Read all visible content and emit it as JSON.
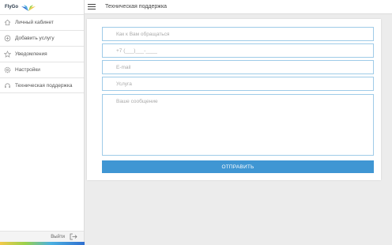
{
  "app": {
    "logo_text": "FlyGo"
  },
  "header": {
    "title": "Техническая поддержка"
  },
  "sidebar": {
    "items": [
      {
        "label": "Личный кабинет",
        "icon": "home-icon"
      },
      {
        "label": "Добавить услугу",
        "icon": "add-circle-icon"
      },
      {
        "label": "Уведомления",
        "icon": "star-icon"
      },
      {
        "label": "Настройки",
        "icon": "gear-icon"
      },
      {
        "label": "Техническая поддержка",
        "icon": "headset-icon"
      }
    ],
    "logout_label": "Выйти"
  },
  "form": {
    "name_placeholder": "Как к Вам обращаться",
    "phone_placeholder": "+7 (___)___-____",
    "email_placeholder": "E-mail",
    "service_placeholder": "Услуга",
    "message_placeholder": "Ваше сообщение",
    "submit_label": "ОТПРАВИТЬ"
  },
  "colors": {
    "accent": "#3f96d3",
    "field_border": "#9fcbe8",
    "background": "#ececec"
  }
}
